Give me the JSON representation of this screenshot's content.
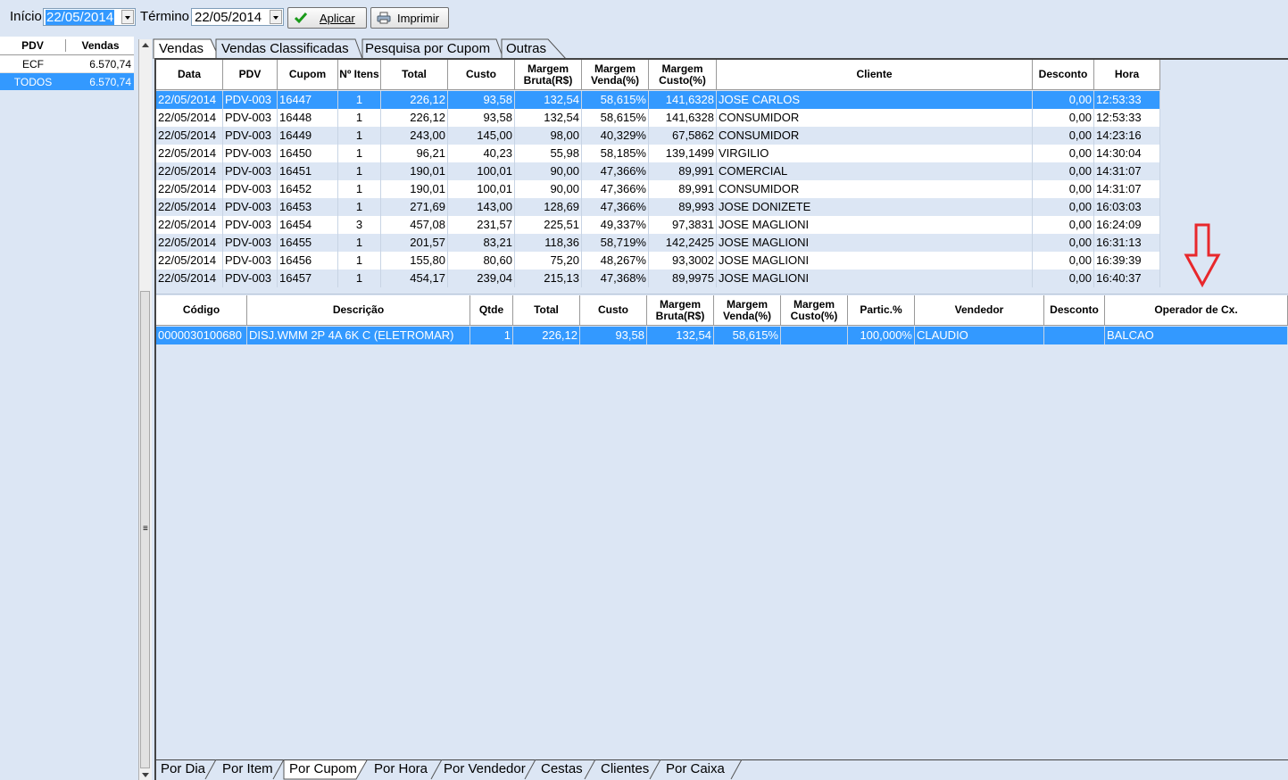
{
  "toolbar": {
    "inicio_label": "Início",
    "inicio_value": "22/05/2014",
    "termino_label": "Término",
    "termino_value": "22/05/2014",
    "aplicar_label": "Aplicar",
    "imprimir_label": "Imprimir"
  },
  "pdv_grid": {
    "headers": [
      "PDV",
      "Vendas"
    ],
    "rows": [
      {
        "pdv": "ECF",
        "vendas": "6.570,74"
      },
      {
        "pdv": "TODOS",
        "vendas": "6.570,74"
      }
    ]
  },
  "top_tabs": [
    "Vendas",
    "Vendas Classificadas",
    "Pesquisa por Cupom",
    "Outras"
  ],
  "sales": {
    "headers": [
      "Data",
      "PDV",
      "Cupom",
      "Nº Itens",
      "Total",
      "Custo",
      "Margem Bruta(R$)",
      "Margem Venda(%)",
      "Margem Custo(%)",
      "Cliente",
      "Desconto",
      "Hora"
    ],
    "rows": [
      [
        "22/05/2014",
        "PDV-003",
        "16447",
        "1",
        "226,12",
        "93,58",
        "132,54",
        "58,615%",
        "141,6328",
        "JOSE CARLOS",
        "0,00",
        "12:53:33"
      ],
      [
        "22/05/2014",
        "PDV-003",
        "16448",
        "1",
        "226,12",
        "93,58",
        "132,54",
        "58,615%",
        "141,6328",
        "CONSUMIDOR",
        "0,00",
        "12:53:33"
      ],
      [
        "22/05/2014",
        "PDV-003",
        "16449",
        "1",
        "243,00",
        "145,00",
        "98,00",
        "40,329%",
        "67,5862",
        "CONSUMIDOR",
        "0,00",
        "14:23:16"
      ],
      [
        "22/05/2014",
        "PDV-003",
        "16450",
        "1",
        "96,21",
        "40,23",
        "55,98",
        "58,185%",
        "139,1499",
        "VIRGILIO",
        "0,00",
        "14:30:04"
      ],
      [
        "22/05/2014",
        "PDV-003",
        "16451",
        "1",
        "190,01",
        "100,01",
        "90,00",
        "47,366%",
        "89,991",
        "COMERCIAL",
        "0,00",
        "14:31:07"
      ],
      [
        "22/05/2014",
        "PDV-003",
        "16452",
        "1",
        "190,01",
        "100,01",
        "90,00",
        "47,366%",
        "89,991",
        "CONSUMIDOR",
        "0,00",
        "14:31:07"
      ],
      [
        "22/05/2014",
        "PDV-003",
        "16453",
        "1",
        "271,69",
        "143,00",
        "128,69",
        "47,366%",
        "89,993",
        "JOSE DONIZETE",
        "0,00",
        "16:03:03"
      ],
      [
        "22/05/2014",
        "PDV-003",
        "16454",
        "3",
        "457,08",
        "231,57",
        "225,51",
        "49,337%",
        "97,3831",
        "JOSE MAGLIONI",
        "0,00",
        "16:24:09"
      ],
      [
        "22/05/2014",
        "PDV-003",
        "16455",
        "1",
        "201,57",
        "83,21",
        "118,36",
        "58,719%",
        "142,2425",
        "JOSE MAGLIONI",
        "0,00",
        "16:31:13"
      ],
      [
        "22/05/2014",
        "PDV-003",
        "16456",
        "1",
        "155,80",
        "80,60",
        "75,20",
        "48,267%",
        "93,3002",
        "JOSE MAGLIONI",
        "0,00",
        "16:39:39"
      ],
      [
        "22/05/2014",
        "PDV-003",
        "16457",
        "1",
        "454,17",
        "239,04",
        "215,13",
        "47,368%",
        "89,9975",
        "JOSE MAGLIONI",
        "0,00",
        "16:40:37"
      ]
    ]
  },
  "items": {
    "headers": [
      "Código",
      "Descrição",
      "Qtde",
      "Total",
      "Custo",
      "Margem Bruta(R$)",
      "Margem Venda(%)",
      "Margem Custo(%)",
      "Partic.%",
      "Vendedor",
      "Desconto",
      "Operador de Cx."
    ],
    "rows": [
      [
        "0000030100680",
        "DISJ.WMM 2P 4A 6K C (ELETROMAR)",
        "1",
        "226,12",
        "93,58",
        "132,54",
        "58,615%",
        "",
        "100,000%",
        "CLAUDIO",
        "",
        "BALCAO"
      ]
    ]
  },
  "bottom_tabs": [
    "Por Dia",
    "Por Item",
    "Por Cupom",
    "Por Hora",
    "Por Vendedor",
    "Cestas",
    "Clientes",
    "Por Caixa"
  ],
  "colors": {
    "background": "#dce6f4",
    "selection": "#3399ff",
    "arrow": "#e8282c"
  },
  "icons": [
    "checkmark-icon",
    "printer-icon",
    "dropdown-arrow-icon",
    "down-arrow-annotation-icon"
  ]
}
